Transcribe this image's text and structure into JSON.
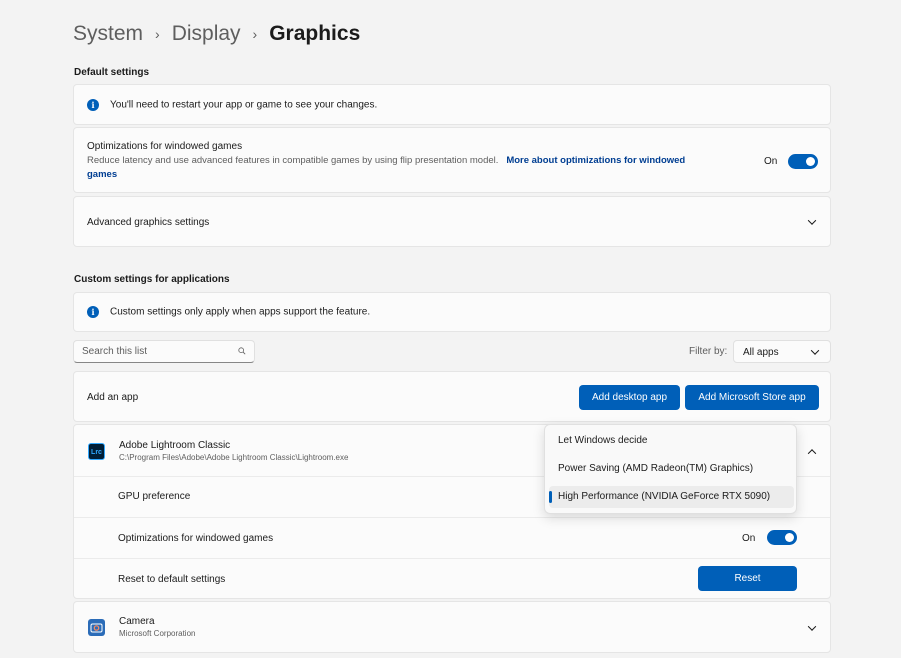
{
  "breadcrumb": {
    "item1": "System",
    "item2": "Display",
    "current": "Graphics",
    "separator": "›"
  },
  "default_settings": {
    "heading": "Default settings",
    "info_text": "You'll need to restart your app or game to see your changes.",
    "optimizations": {
      "title": "Optimizations for windowed games",
      "desc": "Reduce latency and use advanced features in compatible games by using flip presentation model.",
      "link": "More about optimizations for windowed",
      "link_cont": "games",
      "toggle_label": "On",
      "toggle_on": true
    },
    "advanced_label": "Advanced graphics settings"
  },
  "custom_settings": {
    "heading": "Custom settings for applications",
    "info_text": "Custom settings only apply when apps support the feature.",
    "search_placeholder": "Search this list",
    "filter_label": "Filter by:",
    "filter_value": "All apps",
    "add_app_label": "Add an app",
    "add_desktop_btn": "Add desktop app",
    "add_store_btn": "Add Microsoft Store app"
  },
  "apps": [
    {
      "name": "Adobe Lightroom Classic",
      "path": "C:\\Program Files\\Adobe\\Adobe Lightroom Classic\\Lightroom.exe",
      "icon_text": "Lrc",
      "icon_color": "#001e36",
      "expanded": true,
      "gpu_pref_label": "GPU preference",
      "windowed_label": "Optimizations for windowed games",
      "windowed_toggle_label": "On",
      "reset_label": "Reset to default settings",
      "reset_btn": "Reset"
    },
    {
      "name": "Camera",
      "path": "Microsoft Corporation",
      "icon_text": "camera-icon",
      "icon_color": "#2b6cb8"
    }
  ],
  "gpu_dropdown": {
    "options": [
      "Let Windows decide",
      "Power Saving (AMD Radeon(TM) Graphics)",
      "High Performance (NVIDIA GeForce RTX 5090)"
    ],
    "selected_index": 2
  },
  "colors": {
    "accent": "#005fb8",
    "link": "#003e92",
    "background": "#f3f3f3",
    "card": "#fbfbfb"
  }
}
